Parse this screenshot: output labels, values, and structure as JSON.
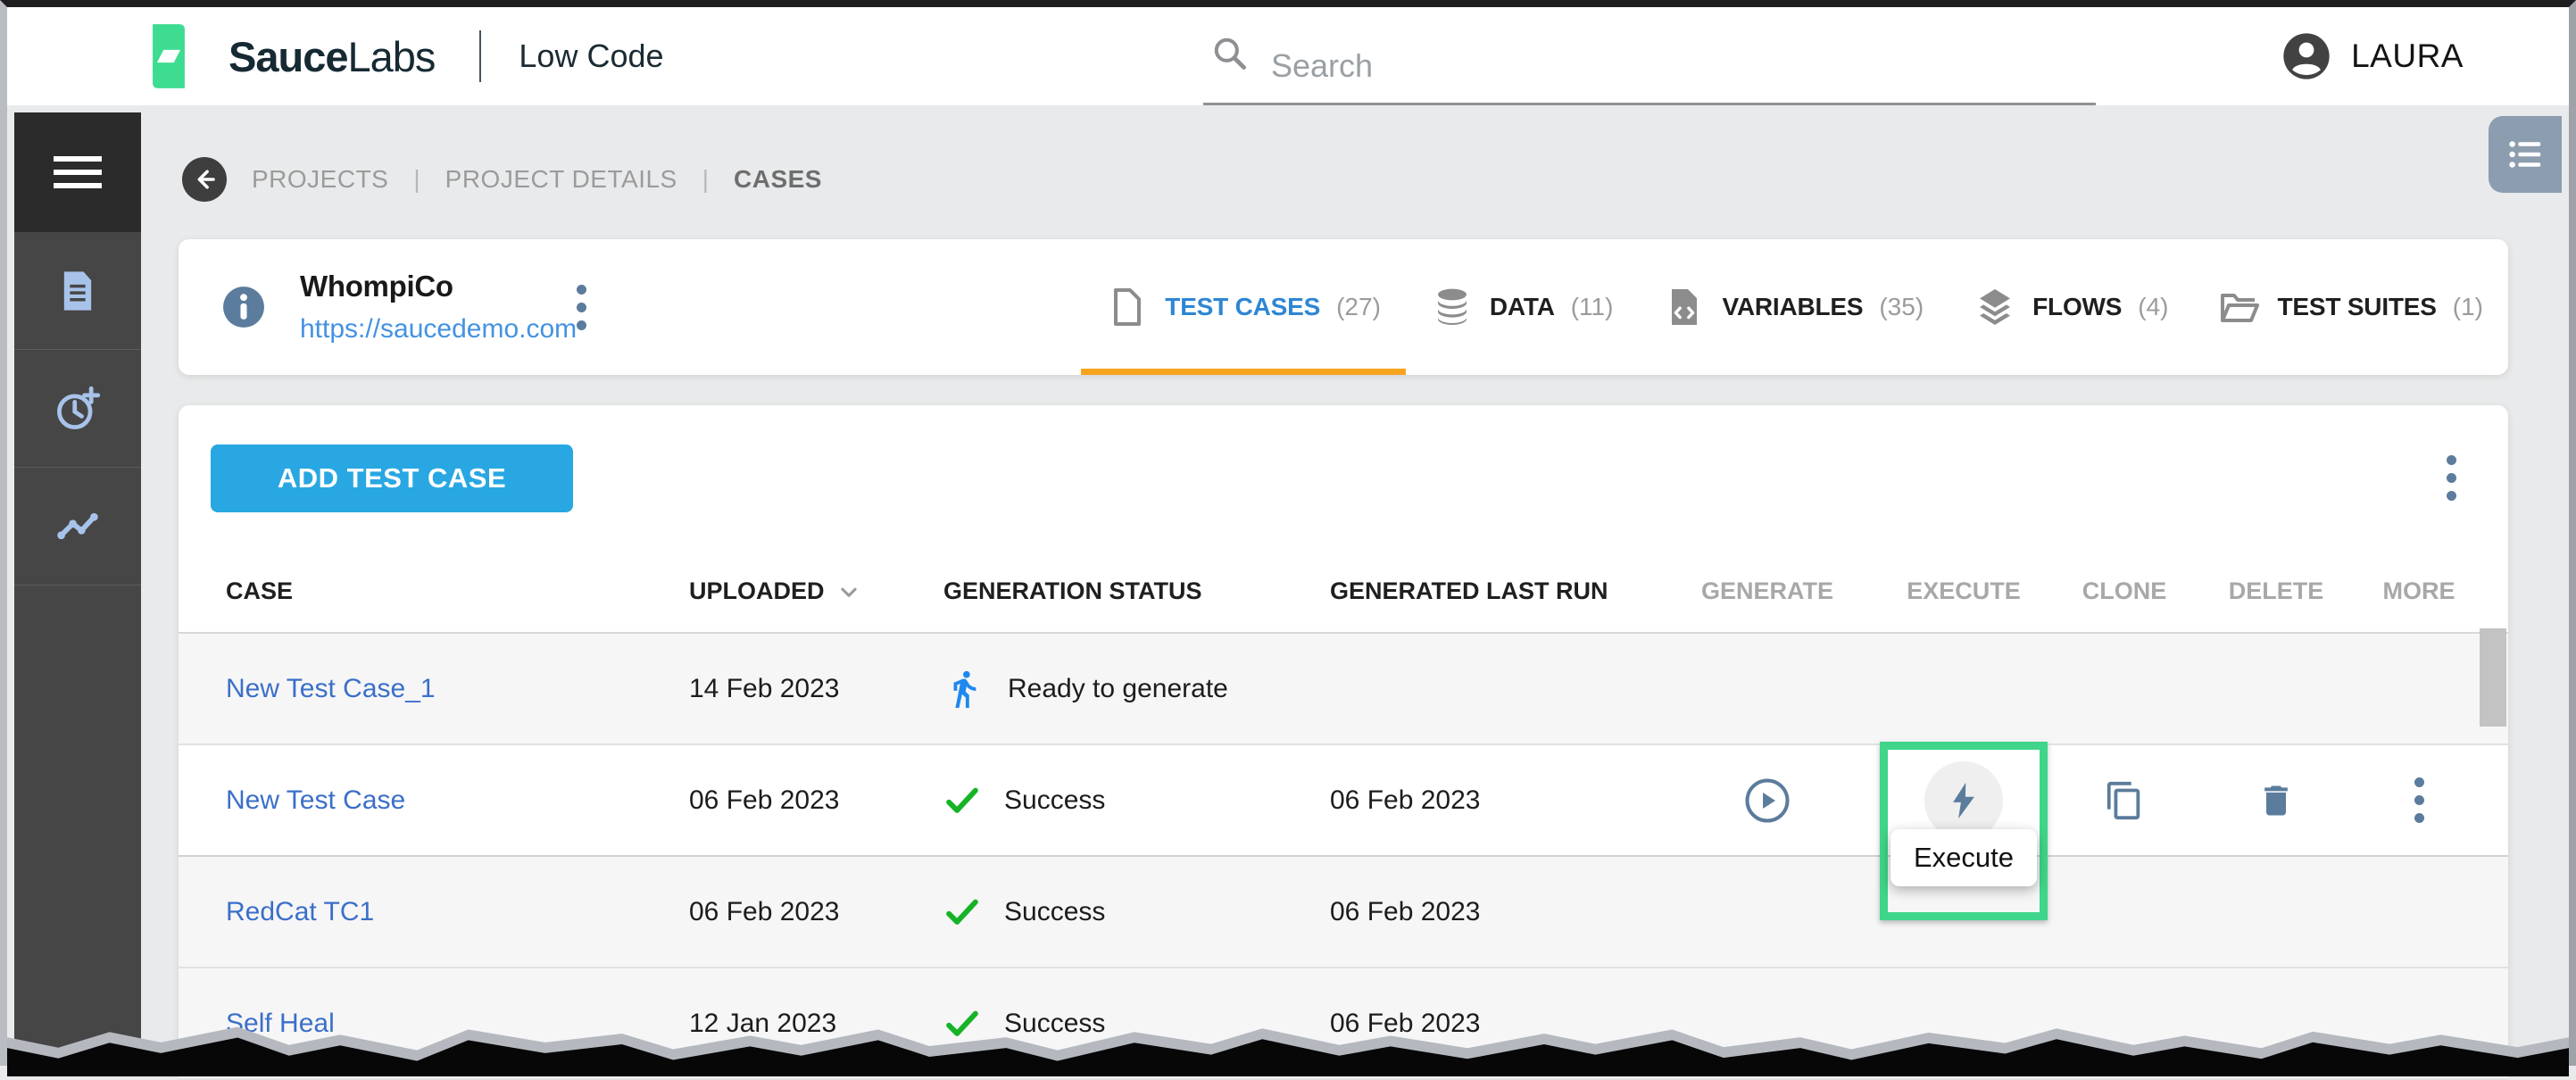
{
  "topbar": {
    "brand_bold": "Sauce",
    "brand_light": "Labs",
    "product": "Low Code",
    "search_placeholder": "Search",
    "user": "LAURA"
  },
  "breadcrumb": {
    "items": [
      "PROJECTS",
      "PROJECT DETAILS",
      "CASES"
    ],
    "separator": "|"
  },
  "project": {
    "name": "WhompiCo",
    "url": "https://saucedemo.com"
  },
  "tabs": [
    {
      "label": "TEST CASES",
      "count": "(27)",
      "active": true
    },
    {
      "label": "DATA",
      "count": "(11)",
      "active": false
    },
    {
      "label": "VARIABLES",
      "count": "(35)",
      "active": false
    },
    {
      "label": "FLOWS",
      "count": "(4)",
      "active": false
    },
    {
      "label": "TEST SUITES",
      "count": "(1)",
      "active": false
    }
  ],
  "toolbar": {
    "add_button": "ADD TEST CASE"
  },
  "table": {
    "columns": [
      "CASE",
      "UPLOADED",
      "GENERATION STATUS",
      "GENERATED LAST RUN",
      "GENERATE",
      "EXECUTE",
      "CLONE",
      "DELETE",
      "MORE"
    ],
    "sorted_column": "UPLOADED",
    "tooltip": "Execute",
    "rows": [
      {
        "case": "New Test Case_1",
        "uploaded": "14 Feb 2023",
        "status": {
          "type": "ready",
          "label": "Ready to generate"
        },
        "last_run": "",
        "actions_visible": false,
        "highlight_execute": false
      },
      {
        "case": "New Test Case",
        "uploaded": "06 Feb 2023",
        "status": {
          "type": "success",
          "label": "Success"
        },
        "last_run": "06 Feb 2023",
        "actions_visible": true,
        "highlight_execute": true
      },
      {
        "case": "RedCat TC1",
        "uploaded": "06 Feb 2023",
        "status": {
          "type": "success",
          "label": "Success"
        },
        "last_run": "06 Feb 2023",
        "actions_visible": false,
        "highlight_execute": false
      },
      {
        "case": "Self Heal",
        "uploaded": "12 Jan 2023",
        "status": {
          "type": "success",
          "label": "Success"
        },
        "last_run": "06 Feb 2023",
        "actions_visible": false,
        "highlight_execute": false
      }
    ]
  },
  "colors": {
    "accent_blue": "#29a7e2",
    "tab_active": "#2e86d4",
    "tab_underline": "#f7a41d",
    "action_icon": "#5b7c9c",
    "success_green": "#17b327",
    "run_blue": "#1e88f0",
    "highlight_green": "#3fd58a",
    "sidebar_icon": "#a8c3ea"
  }
}
